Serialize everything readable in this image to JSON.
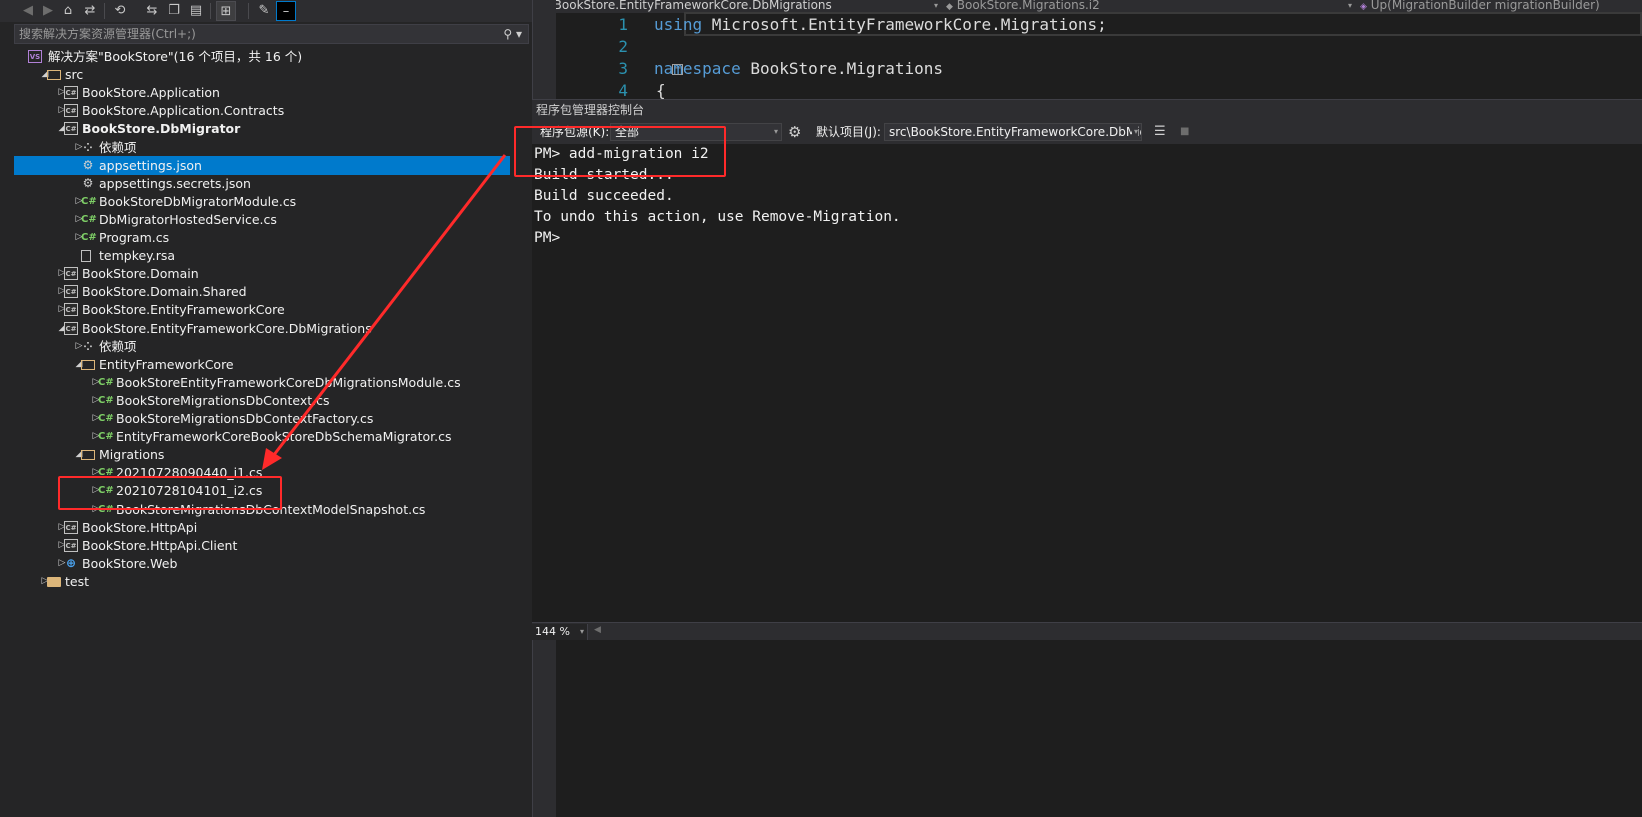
{
  "solution_explorer": {
    "search_placeholder": "搜索解决方案资源管理器(Ctrl+;)",
    "tree": [
      {
        "depth": 0,
        "arrow": "",
        "icon": "sln",
        "label": "解决方案\"BookStore\"(16 个项目，共 16 个)",
        "bold": false,
        "selected": false
      },
      {
        "depth": 1,
        "arrow": "open",
        "icon": "folder-open",
        "label": "src",
        "bold": false,
        "selected": false
      },
      {
        "depth": 2,
        "arrow": "closed",
        "icon": "proj",
        "label": "BookStore.Application",
        "bold": false,
        "selected": false
      },
      {
        "depth": 2,
        "arrow": "closed",
        "icon": "proj",
        "label": "BookStore.Application.Contracts",
        "bold": false,
        "selected": false
      },
      {
        "depth": 2,
        "arrow": "open",
        "icon": "proj",
        "label": "BookStore.DbMigrator",
        "bold": true,
        "selected": false
      },
      {
        "depth": 3,
        "arrow": "closed",
        "icon": "dep",
        "label": "依赖项",
        "bold": false,
        "selected": false
      },
      {
        "depth": 3,
        "arrow": "",
        "icon": "json",
        "label": "appsettings.json",
        "bold": false,
        "selected": true
      },
      {
        "depth": 3,
        "arrow": "",
        "icon": "json",
        "label": "appsettings.secrets.json",
        "bold": false,
        "selected": false
      },
      {
        "depth": 3,
        "arrow": "closed",
        "icon": "cs",
        "label": "BookStoreDbMigratorModule.cs",
        "bold": false,
        "selected": false
      },
      {
        "depth": 3,
        "arrow": "closed",
        "icon": "cs",
        "label": "DbMigratorHostedService.cs",
        "bold": false,
        "selected": false
      },
      {
        "depth": 3,
        "arrow": "closed",
        "icon": "cs",
        "label": "Program.cs",
        "bold": false,
        "selected": false
      },
      {
        "depth": 3,
        "arrow": "",
        "icon": "file",
        "label": "tempkey.rsa",
        "bold": false,
        "selected": false
      },
      {
        "depth": 2,
        "arrow": "closed",
        "icon": "proj",
        "label": "BookStore.Domain",
        "bold": false,
        "selected": false
      },
      {
        "depth": 2,
        "arrow": "closed",
        "icon": "proj",
        "label": "BookStore.Domain.Shared",
        "bold": false,
        "selected": false
      },
      {
        "depth": 2,
        "arrow": "closed",
        "icon": "proj",
        "label": "BookStore.EntityFrameworkCore",
        "bold": false,
        "selected": false
      },
      {
        "depth": 2,
        "arrow": "open",
        "icon": "proj",
        "label": "BookStore.EntityFrameworkCore.DbMigrations",
        "bold": false,
        "selected": false
      },
      {
        "depth": 3,
        "arrow": "closed",
        "icon": "dep",
        "label": "依赖项",
        "bold": false,
        "selected": false
      },
      {
        "depth": 3,
        "arrow": "open",
        "icon": "folder-open",
        "label": "EntityFrameworkCore",
        "bold": false,
        "selected": false
      },
      {
        "depth": 4,
        "arrow": "closed",
        "icon": "cs",
        "label": "BookStoreEntityFrameworkCoreDbMigrationsModule.cs",
        "bold": false,
        "selected": false
      },
      {
        "depth": 4,
        "arrow": "closed",
        "icon": "cs",
        "label": "BookStoreMigrationsDbContext.cs",
        "bold": false,
        "selected": false
      },
      {
        "depth": 4,
        "arrow": "closed",
        "icon": "cs",
        "label": "BookStoreMigrationsDbContextFactory.cs",
        "bold": false,
        "selected": false
      },
      {
        "depth": 4,
        "arrow": "closed",
        "icon": "cs",
        "label": "EntityFrameworkCoreBookStoreDbSchemaMigrator.cs",
        "bold": false,
        "selected": false
      },
      {
        "depth": 3,
        "arrow": "open",
        "icon": "folder-open",
        "label": "Migrations",
        "bold": false,
        "selected": false
      },
      {
        "depth": 4,
        "arrow": "closed",
        "icon": "cs",
        "label": "20210728090440_i1.cs",
        "bold": false,
        "selected": false
      },
      {
        "depth": 4,
        "arrow": "closed",
        "icon": "cs",
        "label": "20210728104101_i2.cs",
        "bold": false,
        "selected": false
      },
      {
        "depth": 4,
        "arrow": "closed",
        "icon": "cs",
        "label": "BookStoreMigrationsDbContextModelSnapshot.cs",
        "bold": false,
        "selected": false
      },
      {
        "depth": 2,
        "arrow": "closed",
        "icon": "proj",
        "label": "BookStore.HttpApi",
        "bold": false,
        "selected": false
      },
      {
        "depth": 2,
        "arrow": "closed",
        "icon": "proj",
        "label": "BookStore.HttpApi.Client",
        "bold": false,
        "selected": false
      },
      {
        "depth": 2,
        "arrow": "closed",
        "icon": "web",
        "label": "BookStore.Web",
        "bold": false,
        "selected": false
      },
      {
        "depth": 1,
        "arrow": "closed",
        "icon": "folder",
        "label": "test",
        "bold": false,
        "selected": false
      }
    ]
  },
  "editor": {
    "nav_project": "BookStore.EntityFrameworkCore.DbMigrations",
    "nav_class": "BookStore.Migrations.i2",
    "nav_member": "Up(MigrationBuilder migrationBuilder)",
    "lines": [
      {
        "num": "1",
        "keyword": "using",
        "text": " Microsoft.EntityFrameworkCore.Migrations;"
      },
      {
        "num": "2",
        "keyword": "",
        "text": ""
      },
      {
        "num": "3",
        "keyword": "namespace",
        "text": " BookStore.Migrations"
      },
      {
        "num": "4",
        "keyword": "",
        "text": "{"
      }
    ]
  },
  "package_manager_console": {
    "title": "程序包管理器控制台",
    "source_label": "程序包源(K):",
    "source_value": "全部",
    "default_project_label": "默认项目(J):",
    "default_project_value": "src\\BookStore.EntityFrameworkCore.DbMigrations",
    "output": [
      "PM> add-migration i2",
      "Build started...",
      "Build succeeded.",
      "To undo this action, use Remove-Migration.",
      "PM>"
    ],
    "zoom": "144 %"
  },
  "colors": {
    "annotation": "#ff2a2a",
    "selection": "#007acc",
    "keyword": "#569cd6",
    "line_number": "#2b91af"
  }
}
